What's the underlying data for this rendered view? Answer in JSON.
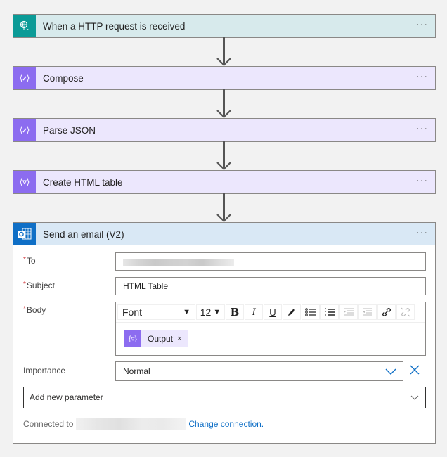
{
  "steps": [
    {
      "title": "When a HTTP request is received",
      "icon": "globe-request-icon",
      "more": "···"
    },
    {
      "title": "Compose",
      "icon": "expression-icon",
      "more": "···"
    },
    {
      "title": "Parse JSON",
      "icon": "expression-icon",
      "more": "···"
    },
    {
      "title": "Create HTML table",
      "icon": "filter-expression-icon",
      "more": "···"
    }
  ],
  "email": {
    "title": "Send an email (V2)",
    "more": "···",
    "required_marker": "*",
    "to": {
      "label": "To",
      "value": ""
    },
    "subject": {
      "label": "Subject",
      "value": "HTML Table"
    },
    "body": {
      "label": "Body",
      "font": "Font",
      "size": "12",
      "toolbar": [
        "bold",
        "italic",
        "underline",
        "pen",
        "bulleted-list",
        "numbered-list",
        "decrease-indent",
        "increase-indent",
        "link",
        "unlink"
      ],
      "bold_glyph": "B",
      "italic_glyph": "I",
      "underline_glyph": "U",
      "token": "Output",
      "token_remove": "×"
    },
    "importance": {
      "label": "Importance",
      "value": "Normal"
    },
    "add_parameter": "Add new parameter",
    "connected_to": "Connected to",
    "change_connection": "Change connection."
  },
  "colors": {
    "trigger_accent": "#0b9b97",
    "action_accent": "#8c6cf0",
    "outlook_accent": "#0f6fc6",
    "required": "#d13438",
    "link": "#0f6fc6"
  }
}
